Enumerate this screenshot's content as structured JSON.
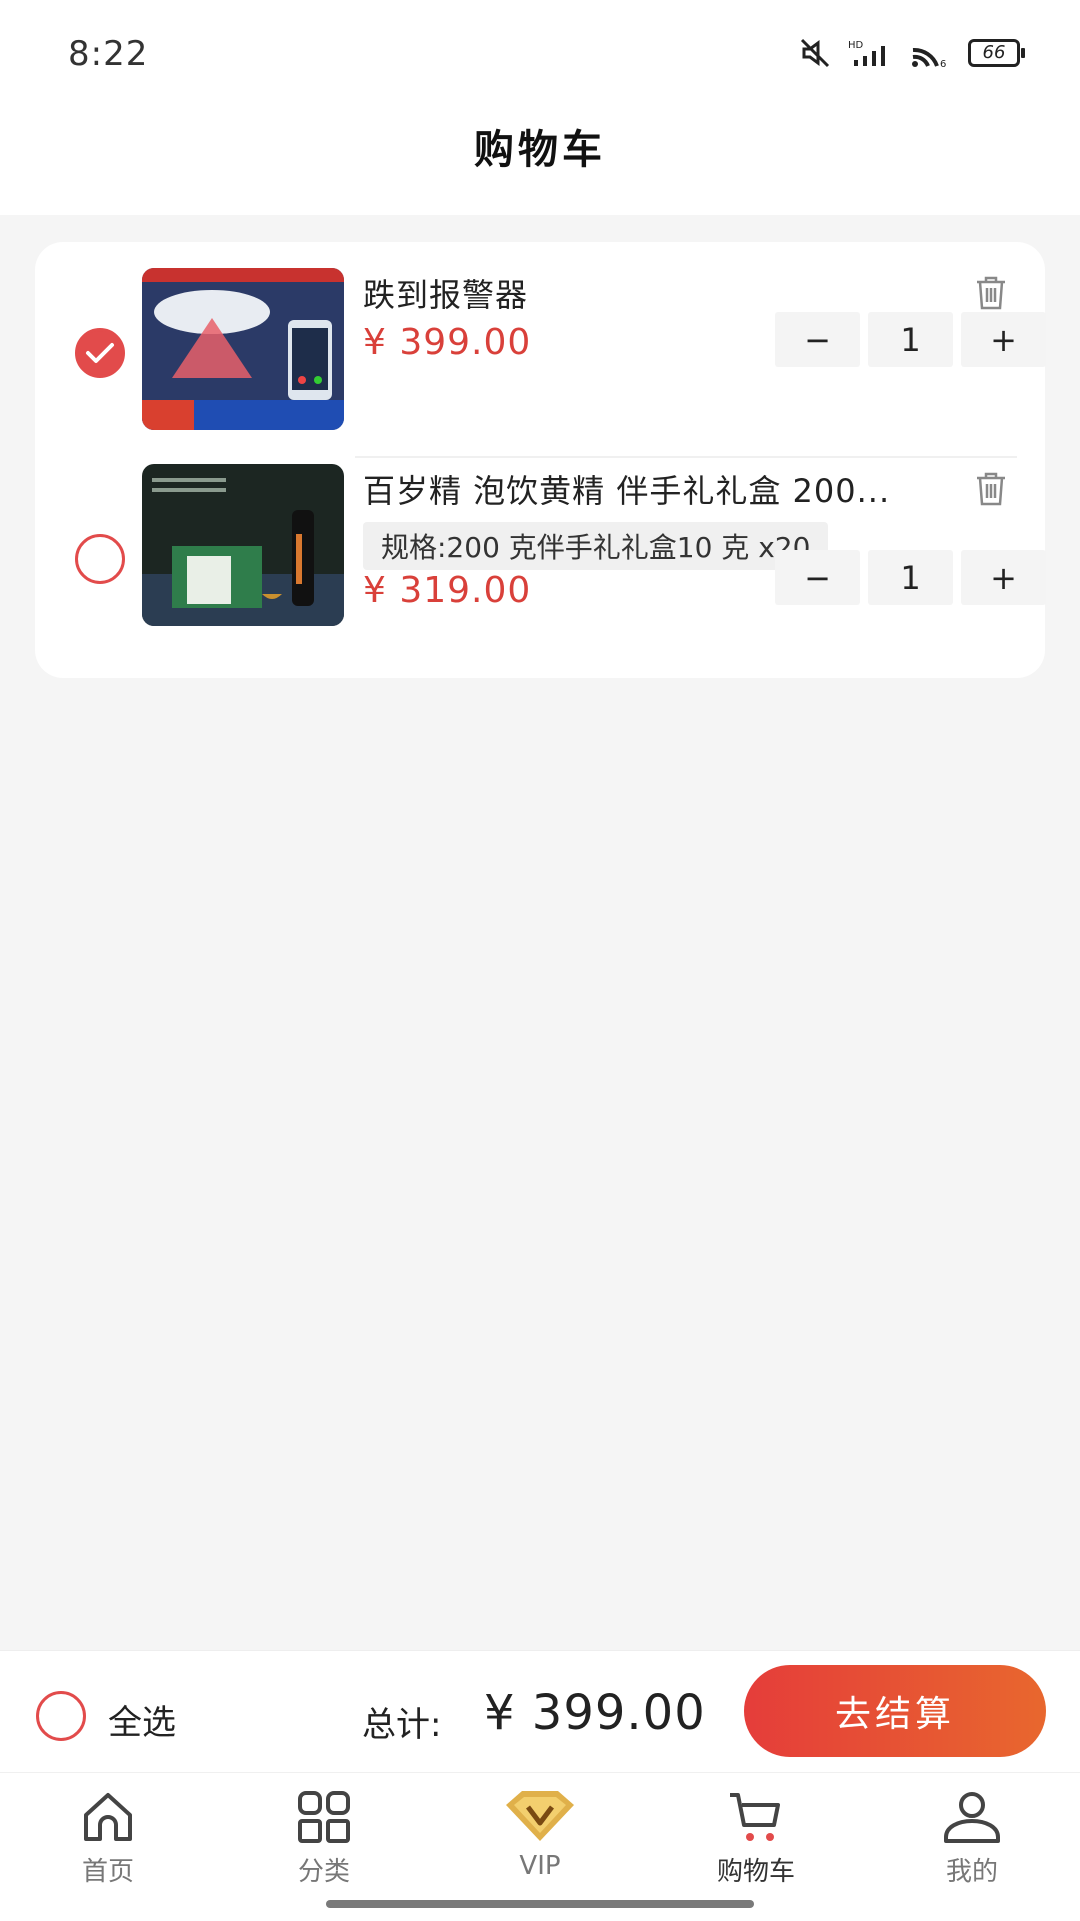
{
  "status_bar": {
    "time": "8:22",
    "battery": "66"
  },
  "header": {
    "title": "购物车"
  },
  "cart": {
    "items": [
      {
        "name": "跌到报警器",
        "price": "¥ 399.00",
        "quantity": "1",
        "selected": true,
        "minus": "−",
        "plus": "+"
      },
      {
        "name": "百岁精 泡饮黄精 伴手礼礼盒 200...",
        "spec": "规格:200 克伴手礼礼盒10 克 x20",
        "price": "¥ 319.00",
        "quantity": "1",
        "selected": false,
        "minus": "−",
        "plus": "+"
      }
    ]
  },
  "footer": {
    "select_all_label": "全选",
    "total_label": "总计:",
    "total_value": "¥ 399.00",
    "checkout_label": "去结算"
  },
  "tabbar": {
    "tabs": [
      {
        "label": "首页",
        "icon": "home-icon"
      },
      {
        "label": "分类",
        "icon": "grid-icon"
      },
      {
        "label": "VIP",
        "icon": "vip-crown-icon"
      },
      {
        "label": "购物车",
        "icon": "cart-icon"
      },
      {
        "label": "我的",
        "icon": "user-icon"
      }
    ],
    "active_index": 3
  },
  "colors": {
    "accent": "#e24b4b",
    "price": "#d9403a",
    "checkout_start": "#e53d3a",
    "checkout_end": "#e8672e"
  }
}
